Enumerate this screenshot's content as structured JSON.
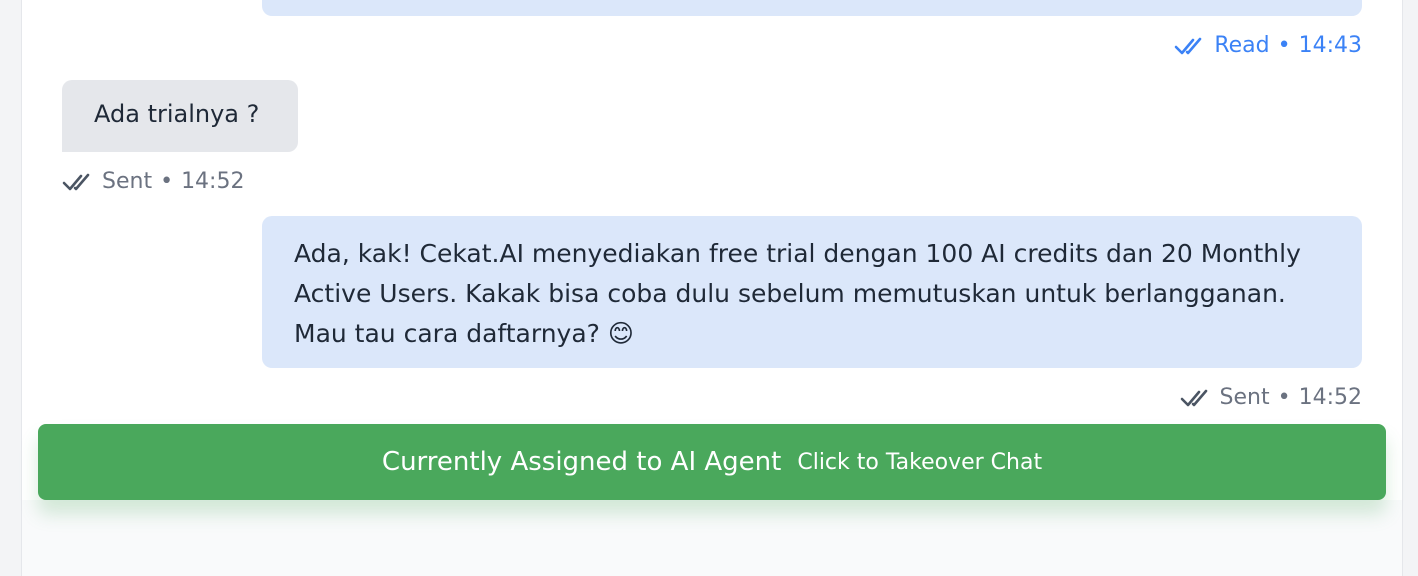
{
  "messages": [
    {
      "direction": "outgoing",
      "status": "Read",
      "time": "14:43"
    },
    {
      "direction": "incoming",
      "text": "Ada trialnya ?",
      "status": "Sent",
      "time": "14:52"
    },
    {
      "direction": "outgoing",
      "lines": [
        "Ada, kak! Cekat.AI menyediakan free trial dengan 100 AI credits dan 20 Monthly",
        "Active Users. Kakak bisa coba dulu sebelum memutuskan untuk berlangganan.",
        "Mau tau cara daftarnya? 😊"
      ],
      "status": "Sent",
      "time": "14:52"
    }
  ],
  "meta_separator": "•",
  "assignment": {
    "title": "Currently Assigned to AI Agent",
    "action": "Click to Takeover Chat"
  },
  "icons": {
    "read_receipt": "double-check-icon",
    "sent_receipt": "double-check-icon"
  },
  "colors": {
    "outgoing_bubble": "#dbe7fa",
    "incoming_bubble": "#e5e7eb",
    "read_status": "#3b82f6",
    "sent_status": "#6b7280",
    "assign_bar": "#4aa85c"
  }
}
